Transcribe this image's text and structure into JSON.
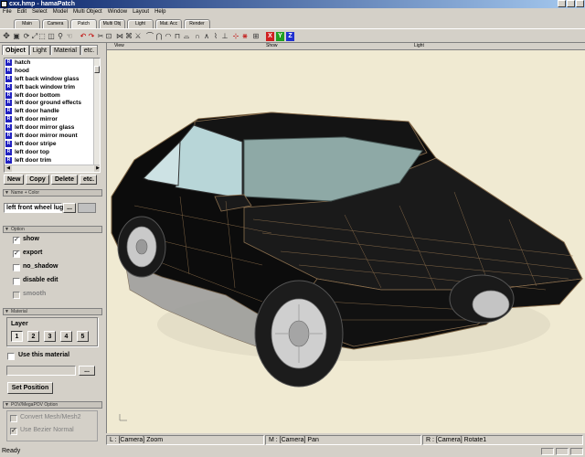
{
  "window": {
    "title": "cxx.hmp - hamaPatch"
  },
  "menu": [
    "File",
    "Edit",
    "Select",
    "Model",
    "Multi Object",
    "Window",
    "Layout",
    "Help"
  ],
  "mode_tabs": [
    "Main",
    "Camera",
    "Patch",
    "Multi Obj",
    "Light",
    "Mat. Acc",
    "Render"
  ],
  "toolbar": {
    "icons": [
      "move-icon",
      "select-icon",
      "rotate-icon",
      "scale-icon",
      "zoom-icon",
      "undo-icon",
      "redo-icon",
      "patch-icons",
      "knife-icon",
      "channel-icons"
    ],
    "axis_buttons": [
      "X",
      "Y",
      "Z"
    ],
    "axis_colors": [
      "#d02020",
      "#20a020",
      "#2030d0"
    ]
  },
  "panel": {
    "tabs": [
      "Object",
      "Light",
      "Material",
      "etc."
    ],
    "objects": [
      "hatch",
      "hood",
      "left back window glass",
      "left back window trim",
      "left door bottom",
      "left door ground effects",
      "left door handle",
      "left door mirror",
      "left door mirror glass",
      "left door mirror mount",
      "left door stripe",
      "left door top",
      "left door trim"
    ],
    "buttons": {
      "new": "New",
      "copy": "Copy",
      "delete": "Delete",
      "etc": "etc."
    },
    "name_color_header": "Name + Color",
    "object_name": "left front wheel lug",
    "browse_button": "...",
    "option_header": "Option",
    "options": [
      {
        "label": "show",
        "checked": true,
        "enabled": true
      },
      {
        "label": "export",
        "checked": true,
        "enabled": true
      },
      {
        "label": "no_shadow",
        "checked": false,
        "enabled": true
      },
      {
        "label": "disable edit",
        "checked": false,
        "enabled": true
      },
      {
        "label": "smooth",
        "checked": false,
        "enabled": false
      }
    ],
    "material_header": "Material",
    "layer_label": "Layer",
    "layers": [
      "1",
      "2",
      "3",
      "4",
      "5"
    ],
    "active_layer": "1",
    "use_material_label": "Use this material",
    "set_position_button": "Set Position",
    "povray_header": "POV/MegaPOV Option",
    "pov_options": [
      "Convert Mesh/Mesh2",
      "Use Bezier Normal"
    ]
  },
  "viewport": {
    "header": {
      "left": "View",
      "center": "Show",
      "right": "Light"
    },
    "background": "#f0ead2"
  },
  "status": {
    "left": "L : [Camera] Zoom",
    "middle": "M : [Camera] Pan",
    "right": "R : [Camera] Rotate1",
    "ready": "Ready"
  }
}
